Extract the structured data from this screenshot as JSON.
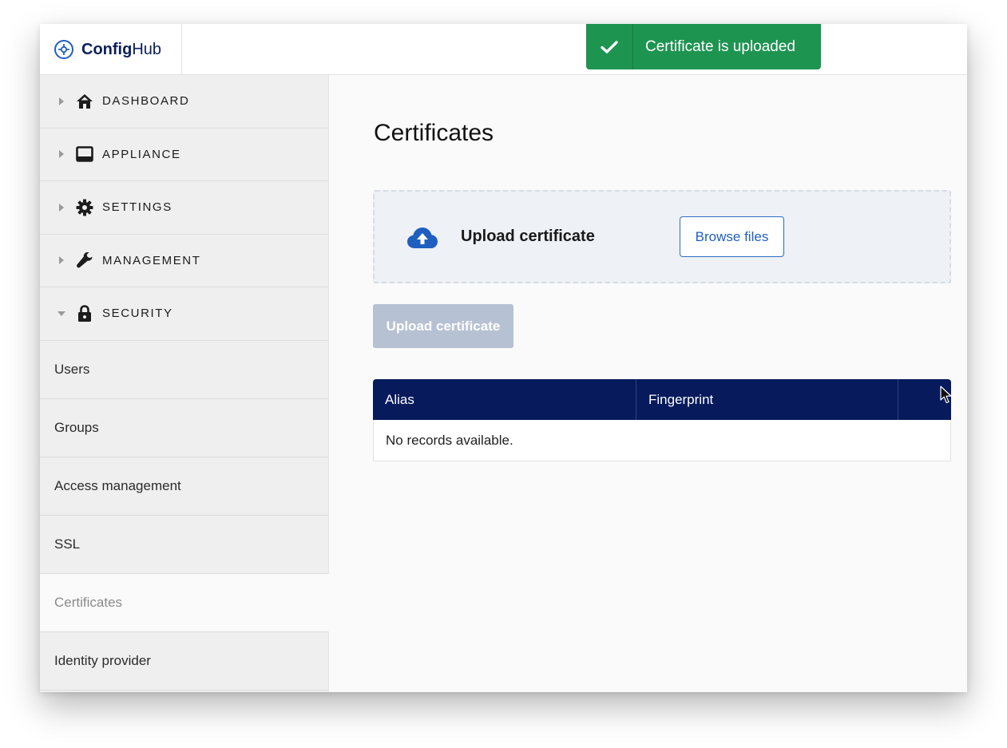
{
  "app": {
    "logo_bold": "Config",
    "logo_regular": "Hub"
  },
  "toast": {
    "message": "Certificate is uploaded",
    "color": "#1e9451"
  },
  "sidebar": {
    "groups": [
      {
        "label": "DASHBOARD",
        "icon": "home-icon",
        "expanded": false
      },
      {
        "label": "APPLIANCE",
        "icon": "appliance-icon",
        "expanded": false
      },
      {
        "label": "SETTINGS",
        "icon": "gear-icon",
        "expanded": false
      },
      {
        "label": "MANAGEMENT",
        "icon": "wrench-icon",
        "expanded": false
      },
      {
        "label": "SECURITY",
        "icon": "lock-icon",
        "expanded": true
      }
    ],
    "security_items": [
      {
        "label": "Users"
      },
      {
        "label": "Groups"
      },
      {
        "label": "Access management"
      },
      {
        "label": "SSL"
      },
      {
        "label": "Certificates",
        "active": true
      },
      {
        "label": "Identity provider"
      }
    ]
  },
  "main": {
    "title": "Certificates",
    "dropzone": {
      "label": "Upload certificate",
      "browse_label": "Browse files",
      "icon": "cloud-upload-icon"
    },
    "upload_button_label": "Upload certificate",
    "table": {
      "columns": [
        "Alias",
        "Fingerprint",
        ""
      ],
      "empty_message": "No records available."
    }
  },
  "colors": {
    "navy": "#061a5c",
    "accent_blue": "#1f5fbf",
    "disabled_button": "#b6c1d4"
  }
}
